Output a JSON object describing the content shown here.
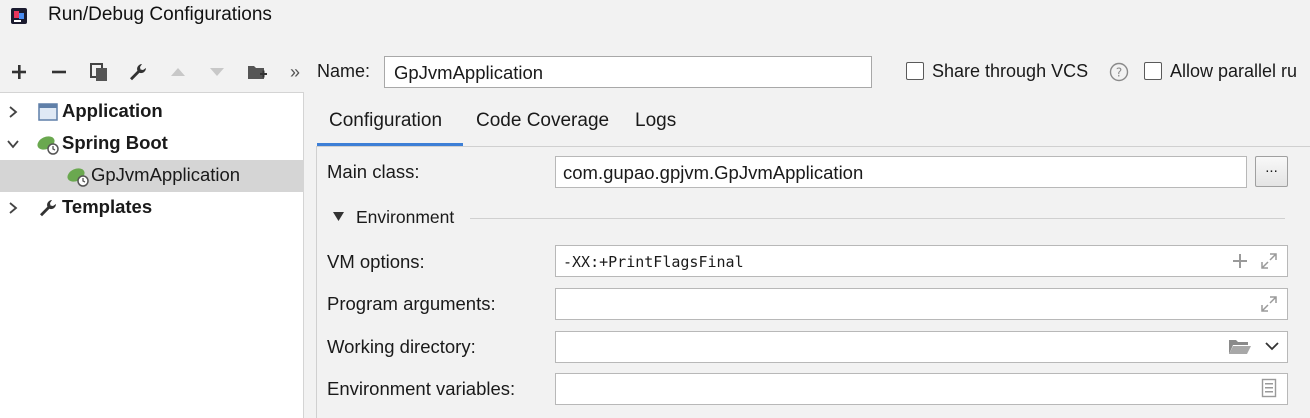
{
  "window": {
    "title": "Run/Debug Configurations"
  },
  "toolbar": {
    "buttons": [
      {
        "name": "add",
        "icon": "plus-icon"
      },
      {
        "name": "remove",
        "icon": "minus-icon"
      },
      {
        "name": "copy",
        "icon": "copy-icon"
      },
      {
        "name": "edit-defaults",
        "icon": "wrench-icon"
      },
      {
        "name": "move-up",
        "icon": "arrow-up-icon"
      },
      {
        "name": "move-down",
        "icon": "arrow-down-icon"
      },
      {
        "name": "new-folder",
        "icon": "folder-add-icon"
      },
      {
        "name": "more",
        "icon": "double-chevron-icon",
        "label": "»"
      }
    ]
  },
  "tree": {
    "items": [
      {
        "label": "Application",
        "expanded": false,
        "icon": "application-icon"
      },
      {
        "label": "Spring Boot",
        "expanded": true,
        "icon": "spring-boot-icon"
      },
      {
        "label": "GpJvmApplication",
        "selected": true,
        "icon": "spring-boot-icon"
      },
      {
        "label": "Templates",
        "expanded": false,
        "icon": "wrench-icon"
      }
    ]
  },
  "header": {
    "name_label": "Name:",
    "name_value": "GpJvmApplication",
    "share_label": "Share through VCS",
    "share_checked": false,
    "parallel_label": "Allow parallel ru",
    "parallel_checked": false
  },
  "tabs": [
    {
      "label": "Configuration",
      "active": true
    },
    {
      "label": "Code Coverage",
      "active": false
    },
    {
      "label": "Logs",
      "active": false
    }
  ],
  "form": {
    "main_class_label": "Main class:",
    "main_class_value": "com.gupao.gpjvm.GpJvmApplication",
    "browse_label": "...",
    "environment_label": "Environment",
    "vm_options_label": "VM options:",
    "vm_options_value": "-XX:+PrintFlagsFinal",
    "program_args_label": "Program arguments:",
    "program_args_value": "",
    "working_dir_label": "Working directory:",
    "working_dir_value": "",
    "env_vars_label": "Environment variables:",
    "env_vars_value": ""
  },
  "colors": {
    "accent": "#3d7fd6",
    "spring_green": "#6aa84f",
    "selection": "#d5d5d5"
  }
}
